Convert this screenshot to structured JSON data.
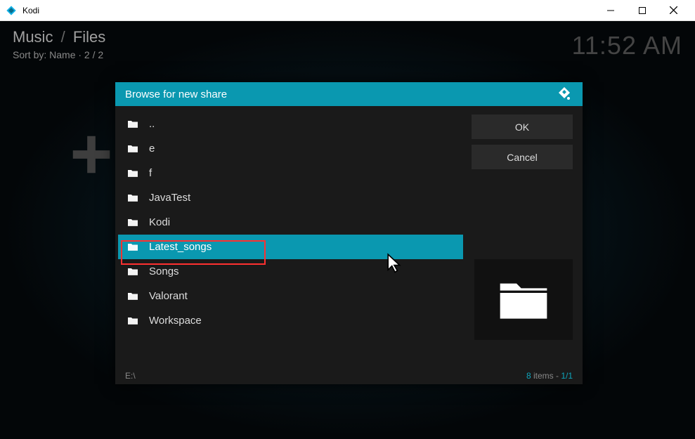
{
  "window": {
    "title": "Kodi"
  },
  "header": {
    "breadcrumb_1": "Music",
    "breadcrumb_2": "Files",
    "sortline": "Sort by: Name  ·  2 / 2",
    "clock": "11:52 AM"
  },
  "dialog": {
    "title": "Browse for new share",
    "items": [
      {
        "label": ".."
      },
      {
        "label": "e"
      },
      {
        "label": "f"
      },
      {
        "label": "JavaTest"
      },
      {
        "label": "Kodi"
      },
      {
        "label": "Latest_songs"
      },
      {
        "label": "Songs"
      },
      {
        "label": "Valorant"
      },
      {
        "label": "Workspace"
      }
    ],
    "selected_index": 5,
    "buttons": {
      "ok": "OK",
      "cancel": "Cancel"
    },
    "footer": {
      "path": "E:\\",
      "count_num": "8",
      "count_label": " items - ",
      "page": "1/1"
    }
  }
}
